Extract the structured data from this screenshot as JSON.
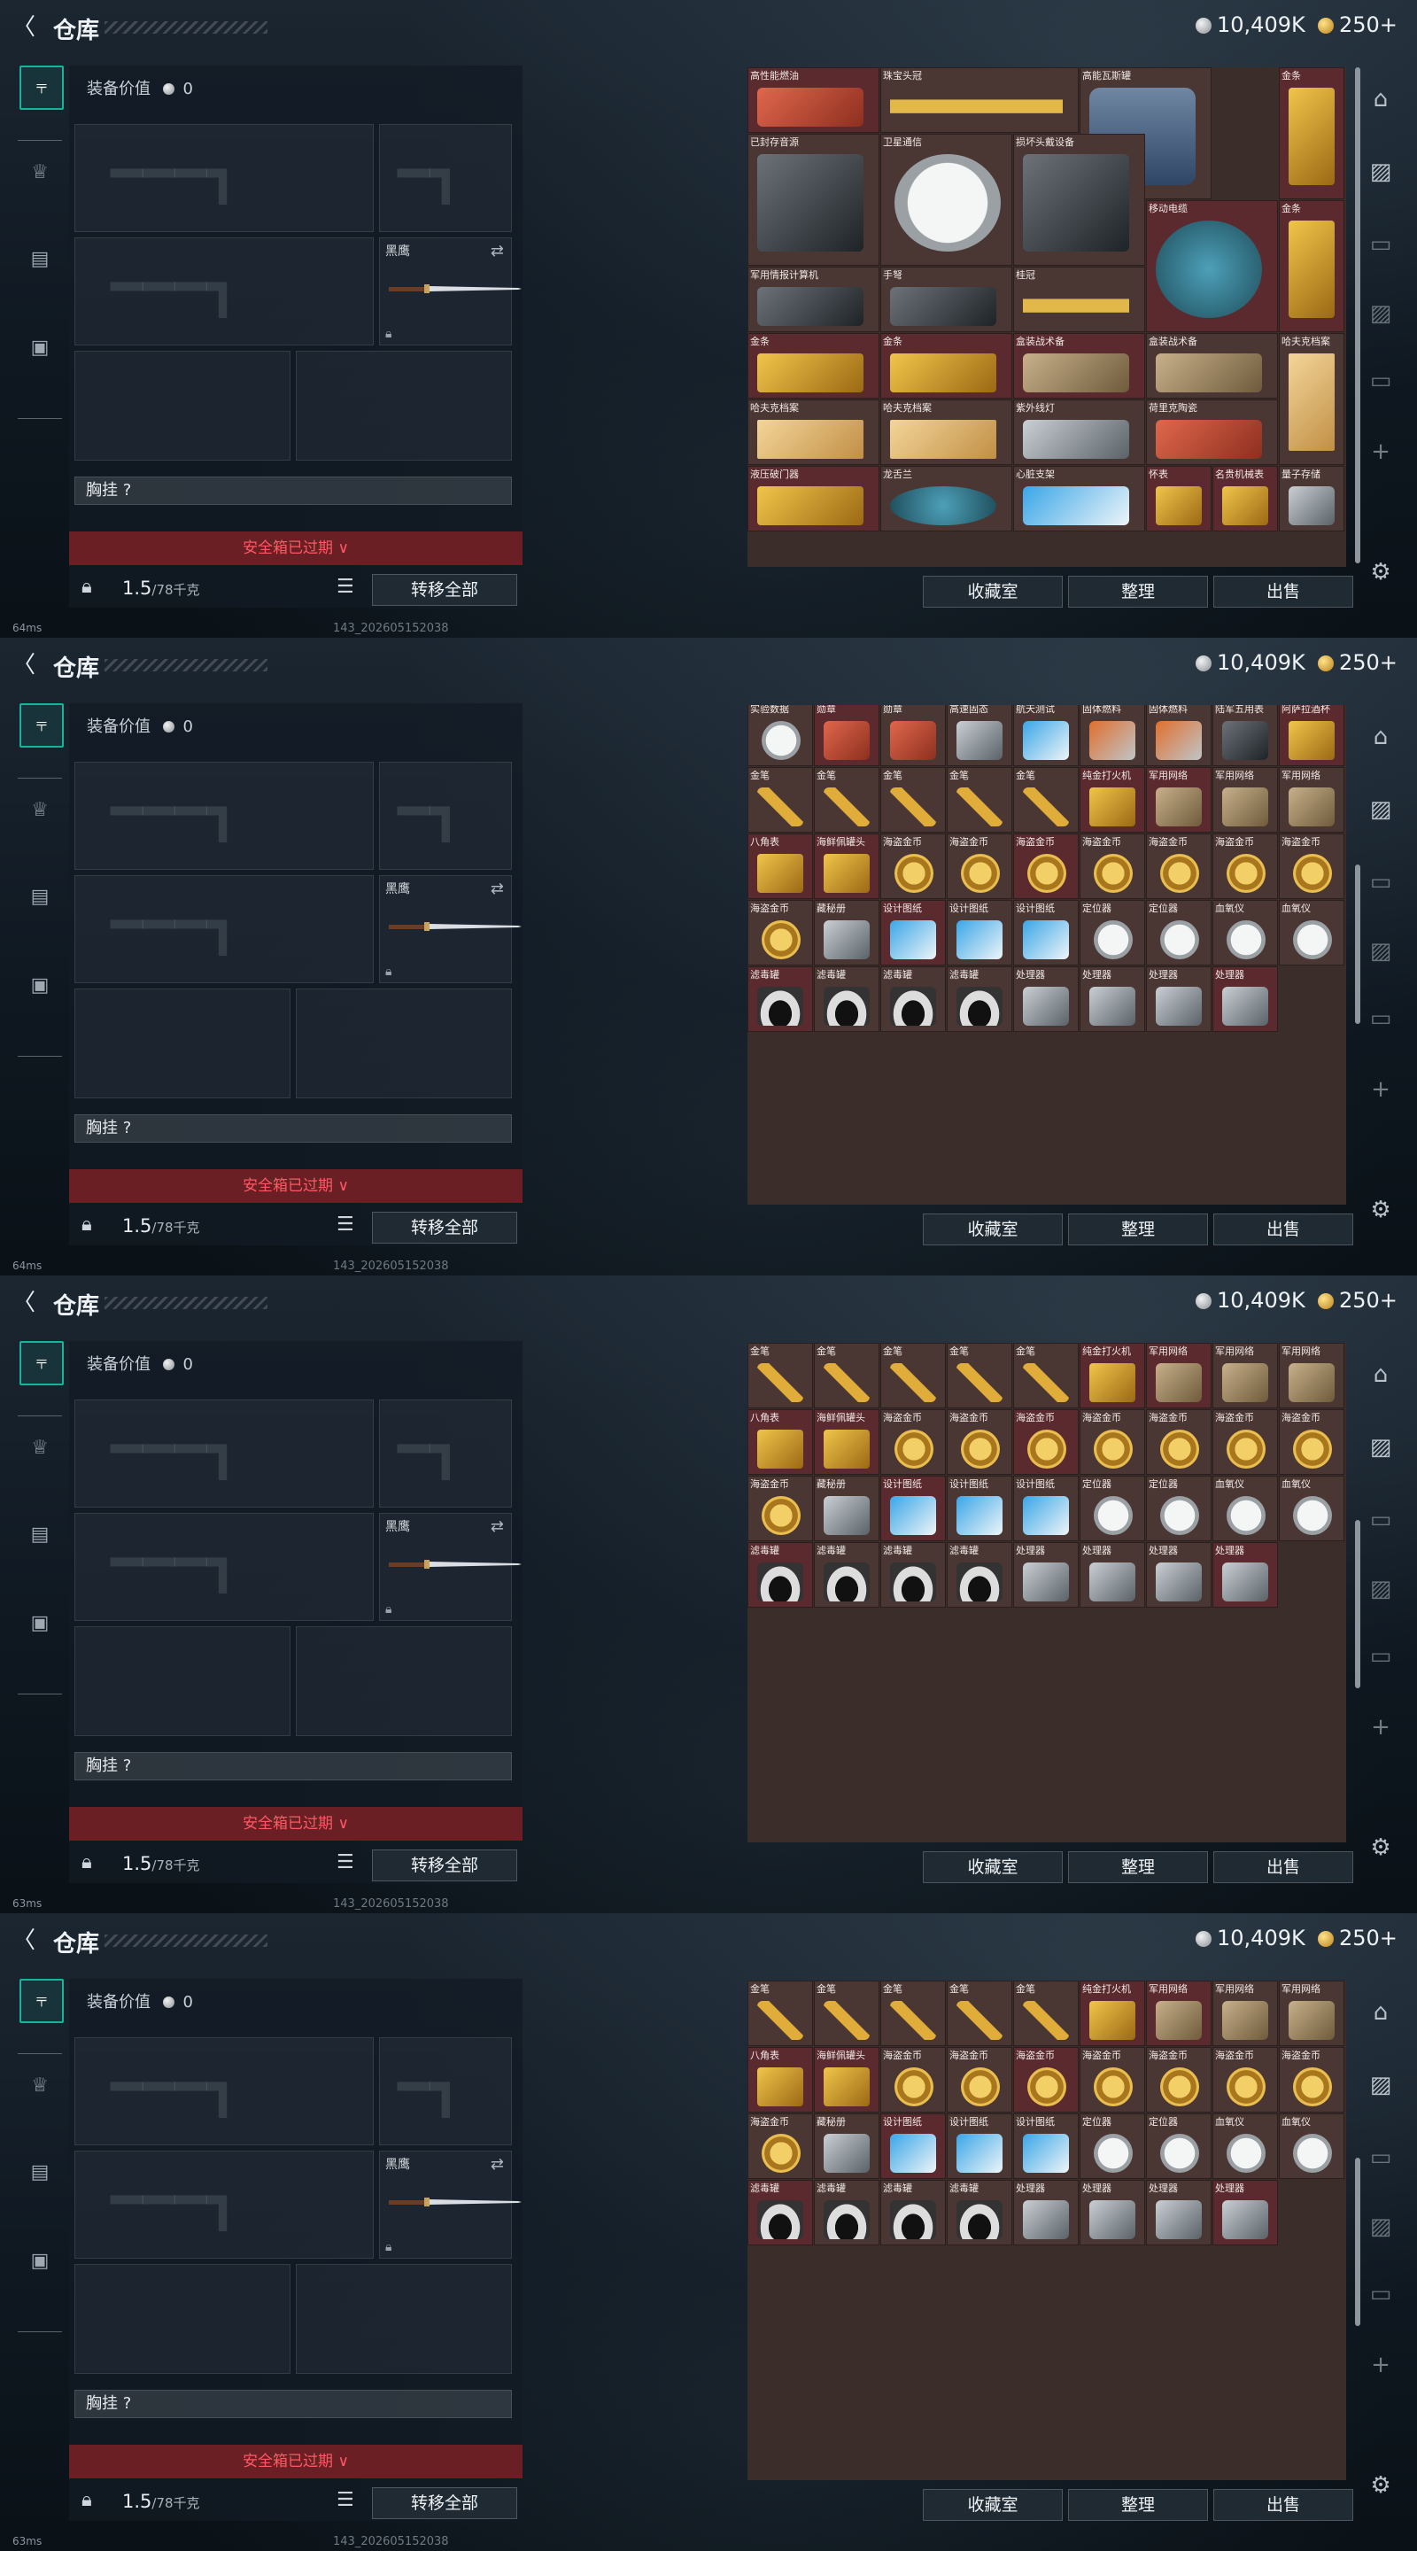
{
  "header": {
    "title": "仓库",
    "silver": "10,409K",
    "gold": "250+"
  },
  "left": {
    "equip_value_label": "装备价值",
    "equip_value": "0",
    "knife_name": "黑鹰",
    "chest_label": "胸挂 ?",
    "expired_label": "安全箱已过期 ∨",
    "weight_value": "1.5",
    "weight_cap": "/78千克",
    "transfer_all": "转移全部"
  },
  "actions": {
    "collection": "收藏室",
    "sort": "整理",
    "sell": "出售"
  },
  "frames": [
    {
      "fps": "64ms",
      "build": "143_202605152038"
    },
    {
      "fps": "64ms",
      "build": "143_202605152038"
    },
    {
      "fps": "63ms",
      "build": "143_202605152038"
    },
    {
      "fps": "63ms",
      "build": "143_202605152038"
    }
  ],
  "grid_frame1": [
    {
      "label": "高性能燃油",
      "icon": "red"
    },
    {
      "label": "珠宝头冠",
      "icon": "crown"
    },
    {
      "label": "高能瓦斯罐",
      "icon": "tank"
    },
    {
      "label": "金条",
      "icon": "gold"
    },
    {
      "label": "已封存音源",
      "icon": "dark"
    },
    {
      "label": "卫星通信",
      "icon": "white"
    },
    {
      "label": "损坏头戴设备",
      "icon": "dark"
    },
    {
      "label": "移动电缆",
      "icon": "teal"
    },
    {
      "label": "金条",
      "icon": "gold"
    },
    {
      "label": "军用情报计算机",
      "icon": "dark"
    },
    {
      "label": "手弩",
      "icon": "dark"
    },
    {
      "label": "桂冠",
      "icon": "crown"
    },
    {
      "label": "金条",
      "icon": "gold"
    },
    {
      "label": "金条",
      "icon": "gold"
    },
    {
      "label": "盒装战术备",
      "icon": "box"
    },
    {
      "label": "盒装战术备",
      "icon": "box"
    },
    {
      "label": "哈夫克档案",
      "icon": "paper"
    },
    {
      "label": "哈夫克档案",
      "icon": "paper"
    },
    {
      "label": "哈夫克档案",
      "icon": "paper"
    },
    {
      "label": "紫外线灯",
      "icon": "grey"
    },
    {
      "label": "荷里克陶瓷",
      "icon": "red"
    },
    {
      "label": "液压破门器",
      "icon": "gold"
    },
    {
      "label": "龙舌兰",
      "icon": "teal"
    },
    {
      "label": "心脏支架",
      "icon": "blue"
    },
    {
      "label": "怀表",
      "icon": "gold"
    },
    {
      "label": "名贵机械表",
      "icon": "gold"
    },
    {
      "label": "量子存储",
      "icon": "grey"
    }
  ],
  "grid_scrolled": [
    {
      "label": "液压破门器",
      "icon": "gold"
    },
    {
      "label": "龙舌兰",
      "icon": "teal"
    },
    {
      "label": "心脏支架",
      "icon": "blue"
    },
    {
      "label": "怀表",
      "icon": "gold"
    },
    {
      "label": "名贵机械表",
      "icon": "gold"
    },
    {
      "label": "量子存储",
      "icon": "grey"
    },
    {
      "label": "实验数据",
      "icon": "white"
    },
    {
      "label": "勋章",
      "icon": "red"
    },
    {
      "label": "勋章",
      "icon": "red"
    },
    {
      "label": "高速固态",
      "icon": "grey"
    },
    {
      "label": "航天测试",
      "icon": "blue"
    },
    {
      "label": "固体燃料",
      "icon": "orange"
    },
    {
      "label": "固体燃料",
      "icon": "orange"
    },
    {
      "label": "陆军五用表",
      "icon": "dark"
    },
    {
      "label": "阿萨拉酒杯",
      "icon": "gold"
    },
    {
      "label": "金笔",
      "icon": "pen"
    },
    {
      "label": "金笔",
      "icon": "pen"
    },
    {
      "label": "金笔",
      "icon": "pen"
    },
    {
      "label": "金笔",
      "icon": "pen"
    },
    {
      "label": "金笔",
      "icon": "pen"
    },
    {
      "label": "纯金打火机",
      "icon": "gold"
    },
    {
      "label": "军用网络",
      "icon": "box"
    },
    {
      "label": "军用网络",
      "icon": "box"
    },
    {
      "label": "军用网络",
      "icon": "box"
    },
    {
      "label": "八角表",
      "icon": "gold"
    },
    {
      "label": "海鲜佩罐头",
      "icon": "gold"
    },
    {
      "label": "海盗金币",
      "icon": "coin"
    },
    {
      "label": "海盗金币",
      "icon": "coin"
    },
    {
      "label": "海盗金币",
      "icon": "coin"
    },
    {
      "label": "海盗金币",
      "icon": "coin"
    },
    {
      "label": "海盗金币",
      "icon": "coin"
    },
    {
      "label": "海盗金币",
      "icon": "coin"
    },
    {
      "label": "海盗金币",
      "icon": "coin"
    },
    {
      "label": "海盗金币",
      "icon": "coin"
    },
    {
      "label": "藏秘册",
      "icon": "grey"
    },
    {
      "label": "设计图纸",
      "icon": "blue"
    },
    {
      "label": "设计图纸",
      "icon": "blue"
    },
    {
      "label": "设计图纸",
      "icon": "blue"
    },
    {
      "label": "定位器",
      "icon": "white"
    },
    {
      "label": "定位器",
      "icon": "white"
    },
    {
      "label": "血氧仪",
      "icon": "white"
    },
    {
      "label": "血氧仪",
      "icon": "white"
    },
    {
      "label": "滤毒罐",
      "icon": "canister"
    },
    {
      "label": "滤毒罐",
      "icon": "canister"
    },
    {
      "label": "滤毒罐",
      "icon": "canister"
    },
    {
      "label": "滤毒罐",
      "icon": "canister"
    },
    {
      "label": "处理器",
      "icon": "grey"
    },
    {
      "label": "处理器",
      "icon": "grey"
    },
    {
      "label": "处理器",
      "icon": "grey"
    },
    {
      "label": "处理器",
      "icon": "grey"
    }
  ]
}
